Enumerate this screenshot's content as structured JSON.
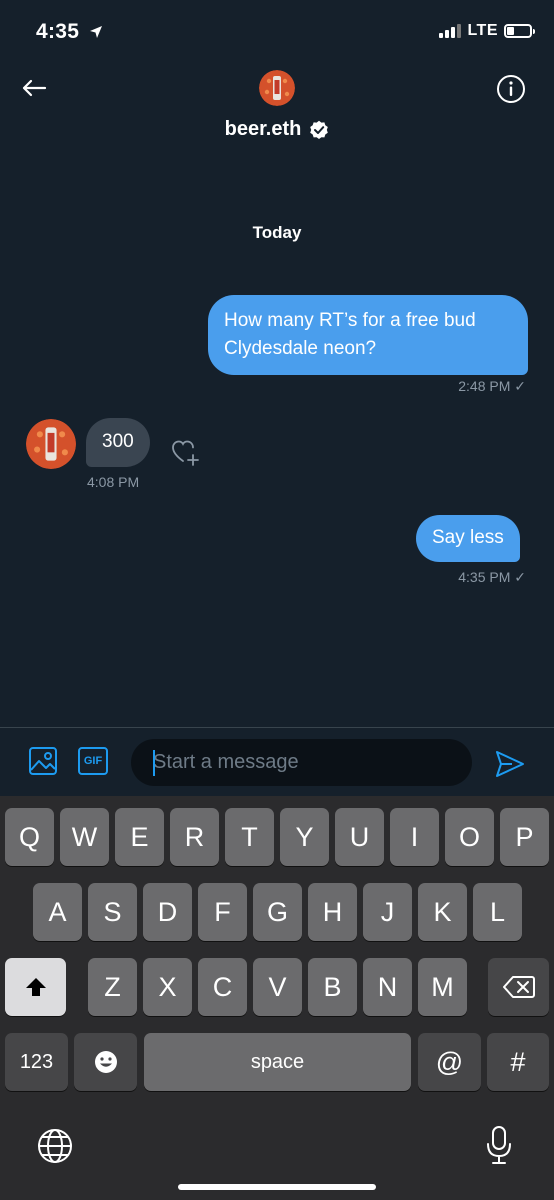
{
  "status": {
    "time": "4:35",
    "network": "LTE",
    "battery_level": 0.3
  },
  "header": {
    "name": "beer.eth"
  },
  "thread": {
    "date_label": "Today",
    "messages": [
      {
        "text": "How many RT’s for a free bud Clydesdale neon?",
        "time": "2:48 PM ✓"
      },
      {
        "text": "300",
        "time": "4:08 PM"
      },
      {
        "text": "Say less",
        "time": "4:35 PM ✓"
      }
    ]
  },
  "composer": {
    "gif_label": "GIF",
    "placeholder": "Start a message"
  },
  "keyboard": {
    "row1": [
      "Q",
      "W",
      "E",
      "R",
      "T",
      "Y",
      "U",
      "I",
      "O",
      "P"
    ],
    "row2": [
      "A",
      "S",
      "D",
      "F",
      "G",
      "H",
      "J",
      "K",
      "L"
    ],
    "row3": [
      "Z",
      "X",
      "C",
      "V",
      "B",
      "N",
      "M"
    ],
    "numbers_label": "123",
    "space_label": "space",
    "at_label": "@",
    "hash_label": "#"
  },
  "icons": {
    "back": "arrow-left-icon",
    "info": "info-icon",
    "verified": "verified-badge-icon",
    "location": "location-arrow-icon",
    "react": "heart-plus-icon",
    "media": "image-icon",
    "send": "send-icon",
    "shift": "shift-icon",
    "backspace": "backspace-icon",
    "emoji": "emoji-icon",
    "globe": "globe-icon",
    "mic": "microphone-icon"
  },
  "colors": {
    "background": "#15202b",
    "accent": "#1d9bf0",
    "bubble_out": "#4a9eed",
    "bubble_in": "#3a4551"
  }
}
